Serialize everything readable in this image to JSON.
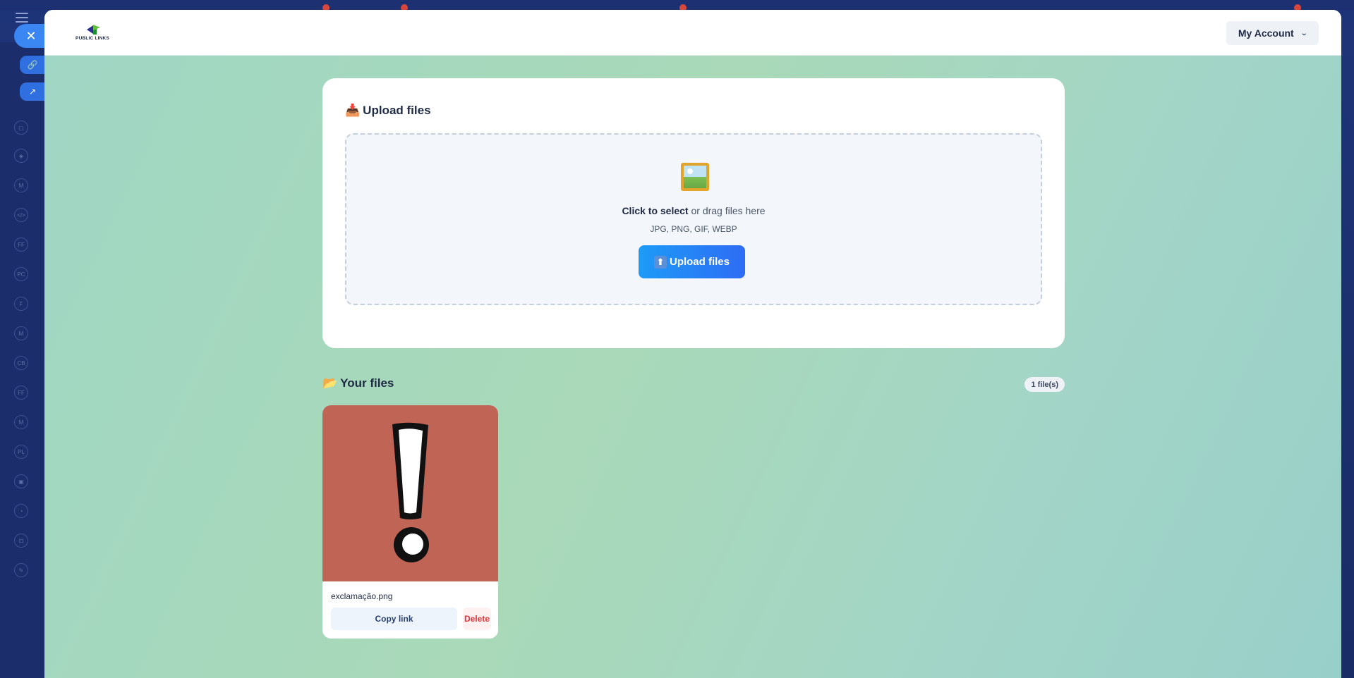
{
  "header": {
    "logo_text": "PUBLIC LINKS",
    "account_label": "My Account"
  },
  "upload": {
    "title": "Upload files",
    "title_emoji": "📥",
    "icon": "framed-picture-icon",
    "click_text": "Click to select",
    "drag_text": " or drag files here",
    "formats": "JPG, PNG, GIF, WEBP",
    "button_label": "Upload files",
    "button_emoji": "⬆"
  },
  "files": {
    "title": "Your files",
    "title_emoji": "📂",
    "count": "1 file(s)",
    "items": [
      {
        "name": "exclamação.png",
        "copy_label": "Copy link",
        "delete_label": "Delete",
        "thumb_color": "#c06556"
      }
    ]
  },
  "colors": {
    "accent": "#2f6cf5",
    "danger": "#e0343a",
    "modal_bg": "#a6d7c4"
  }
}
